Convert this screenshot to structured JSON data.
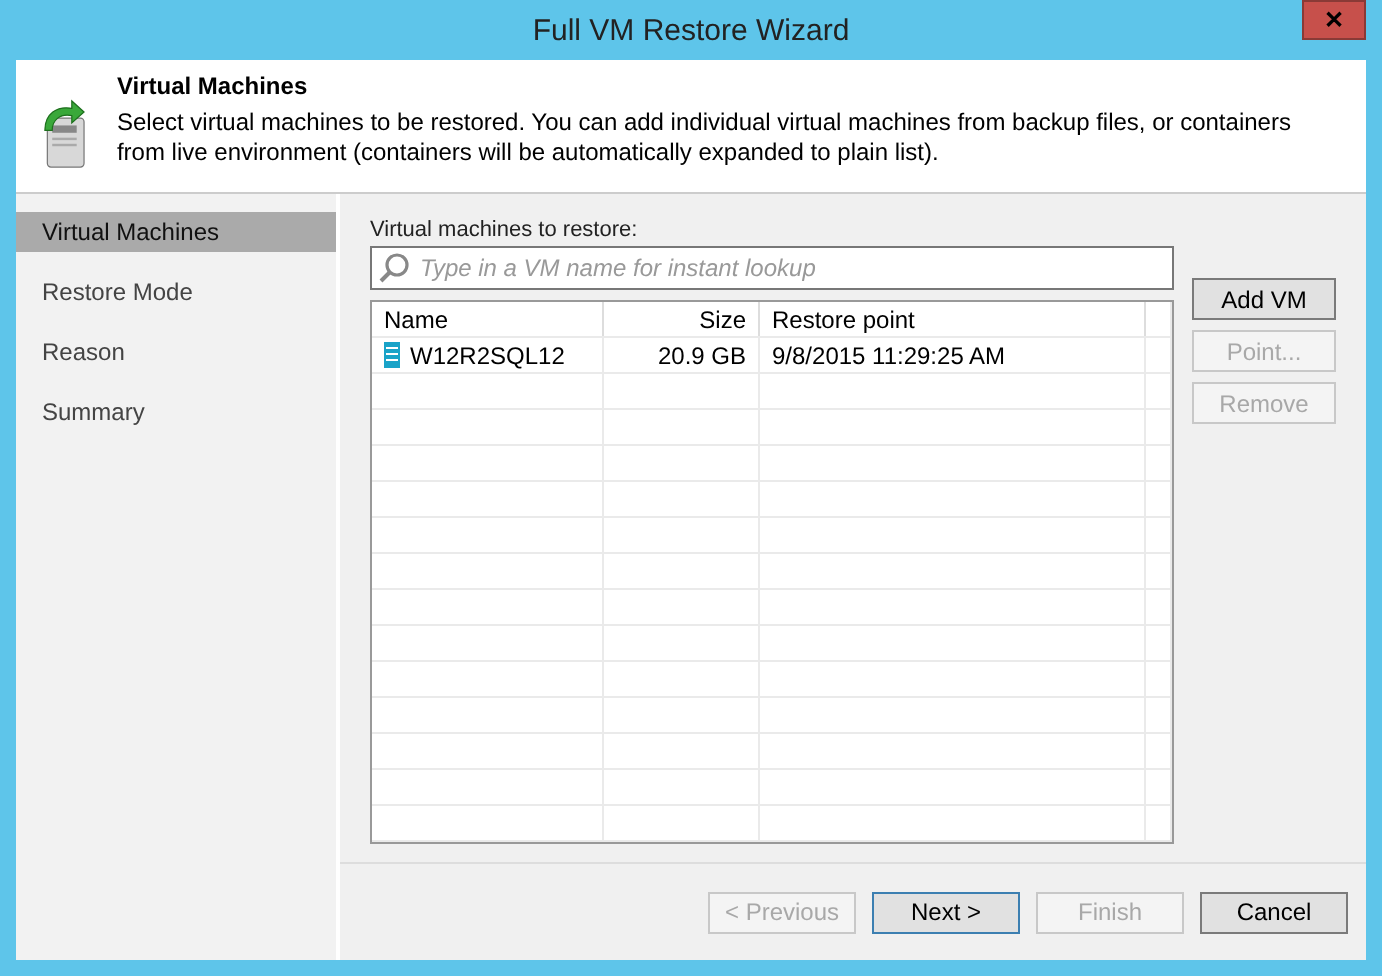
{
  "window": {
    "title": "Full VM Restore Wizard",
    "close": "✕"
  },
  "header": {
    "title": "Virtual Machines",
    "description": "Select virtual machines to be restored. You  can add individual virtual machines from backup files, or containers from live environment (containers will be automatically expanded to plain list)."
  },
  "sidebar": {
    "items": [
      {
        "label": "Virtual Machines",
        "selected": true
      },
      {
        "label": "Restore Mode",
        "selected": false
      },
      {
        "label": "Reason",
        "selected": false
      },
      {
        "label": "Summary",
        "selected": false
      }
    ]
  },
  "list_label": "Virtual machines to restore:",
  "search": {
    "placeholder": "Type in a VM name for instant lookup"
  },
  "table": {
    "columns": [
      "Name",
      "Size",
      "Restore point"
    ],
    "rows": [
      {
        "name": "W12R2SQL12",
        "size": "20.9 GB",
        "restore_point": "9/8/2015 11:29:25 AM"
      }
    ]
  },
  "side_buttons": [
    {
      "label": "Add VM",
      "disabled": false
    },
    {
      "label": "Point...",
      "disabled": true
    },
    {
      "label": "Remove",
      "disabled": true
    }
  ],
  "footer_buttons": [
    {
      "label": "< Previous",
      "disabled": true,
      "focused": false
    },
    {
      "label": "Next >",
      "disabled": false,
      "focused": true
    },
    {
      "label": "Finish",
      "disabled": true,
      "focused": false
    },
    {
      "label": "Cancel",
      "disabled": false,
      "focused": false
    }
  ]
}
